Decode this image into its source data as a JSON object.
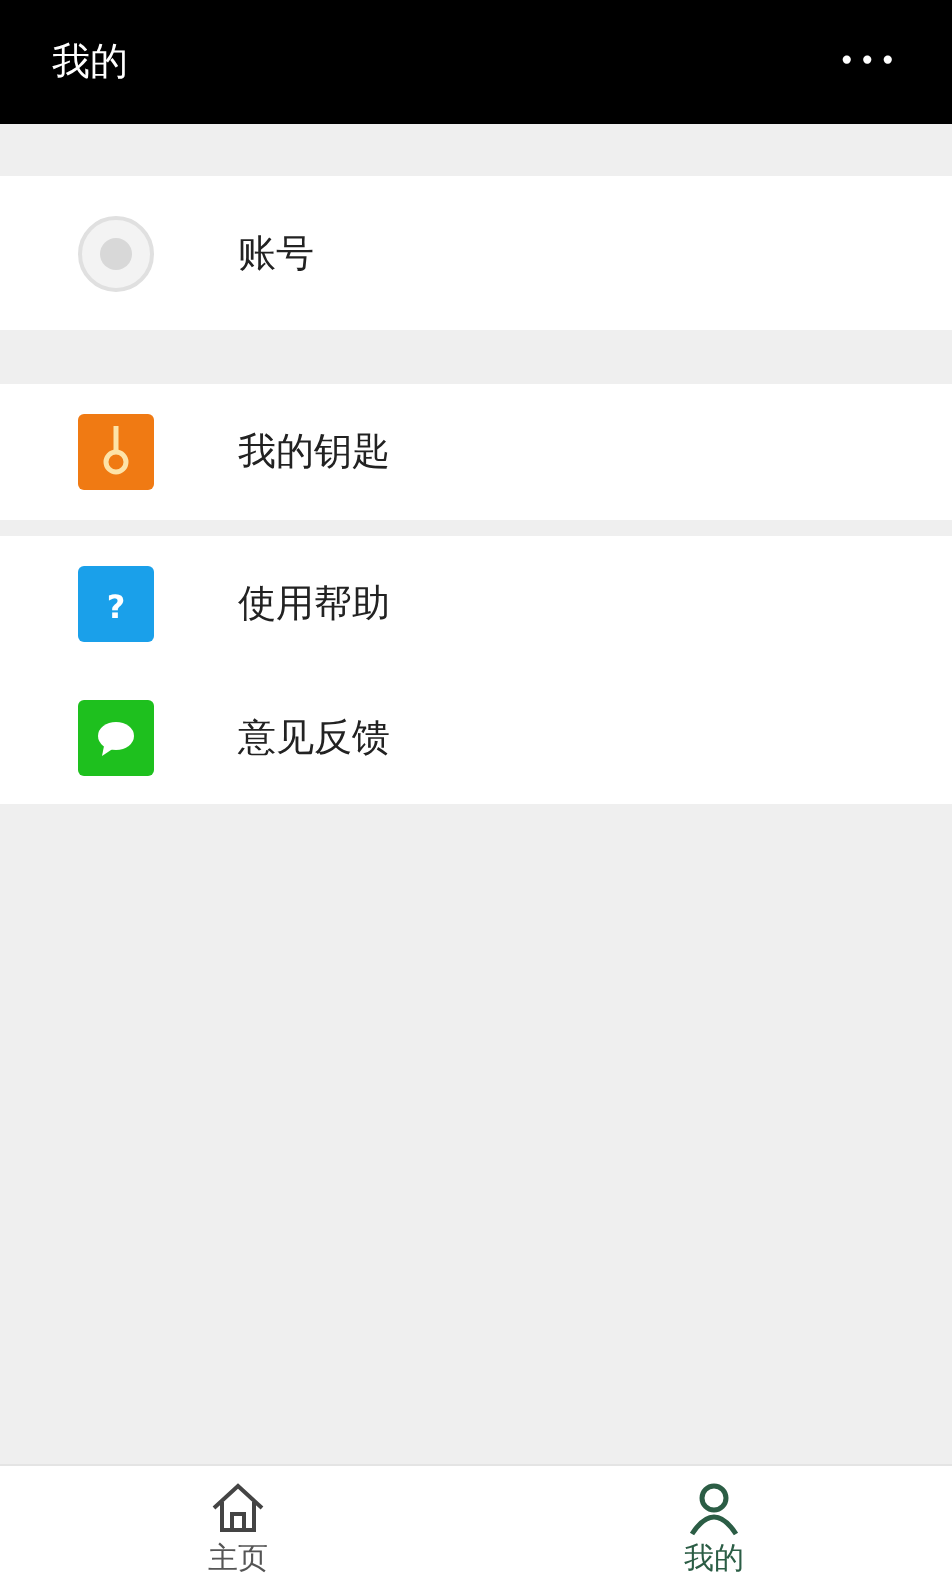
{
  "header": {
    "title": "我的",
    "menu": "•••"
  },
  "account": {
    "label": "账号"
  },
  "sections": [
    [
      {
        "label": "我的钥匙",
        "kind": "key",
        "color": "#f07a13"
      }
    ],
    [
      {
        "label": "使用帮助",
        "kind": "help",
        "color": "#1aa0ea",
        "glyph": "?"
      },
      {
        "label": "意见反馈",
        "kind": "feedback",
        "color": "#1ec01e"
      }
    ]
  ],
  "tabs": [
    {
      "label": "主页",
      "kind": "home",
      "selected": false
    },
    {
      "label": "我的",
      "kind": "person",
      "selected": true
    }
  ]
}
